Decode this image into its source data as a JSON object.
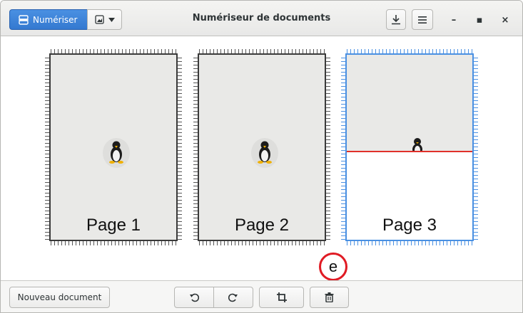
{
  "header": {
    "title": "Numériseur de documents",
    "scan_label": "Numériser",
    "icons": {
      "scan": "scanner-icon",
      "image_type": "image-icon",
      "dropdown": "chevron-down-icon",
      "save": "download-icon",
      "menu": "hamburger-menu-icon",
      "minimize": "minimize-icon",
      "maximize": "maximize-icon",
      "close": "close-icon"
    },
    "window_controls": {
      "minimize": "–",
      "maximize": "▪",
      "close": "×"
    }
  },
  "pages": [
    {
      "label": "Page 1",
      "selected": false,
      "scan_complete": true
    },
    {
      "label": "Page 2",
      "selected": false,
      "scan_complete": true
    },
    {
      "label": "Page 3",
      "selected": true,
      "scan_complete": false
    }
  ],
  "annotation": {
    "label": "e",
    "color": "#e01b24"
  },
  "actionbar": {
    "new_document_label": "Nouveau document",
    "icons": {
      "rotate_left": "rotate-left-icon",
      "rotate_right": "rotate-right-icon",
      "crop": "crop-icon",
      "delete": "trash-icon"
    }
  },
  "colors": {
    "accent": "#3479d0",
    "selected_border": "#4a90e2",
    "scan_line": "#e0302a"
  }
}
